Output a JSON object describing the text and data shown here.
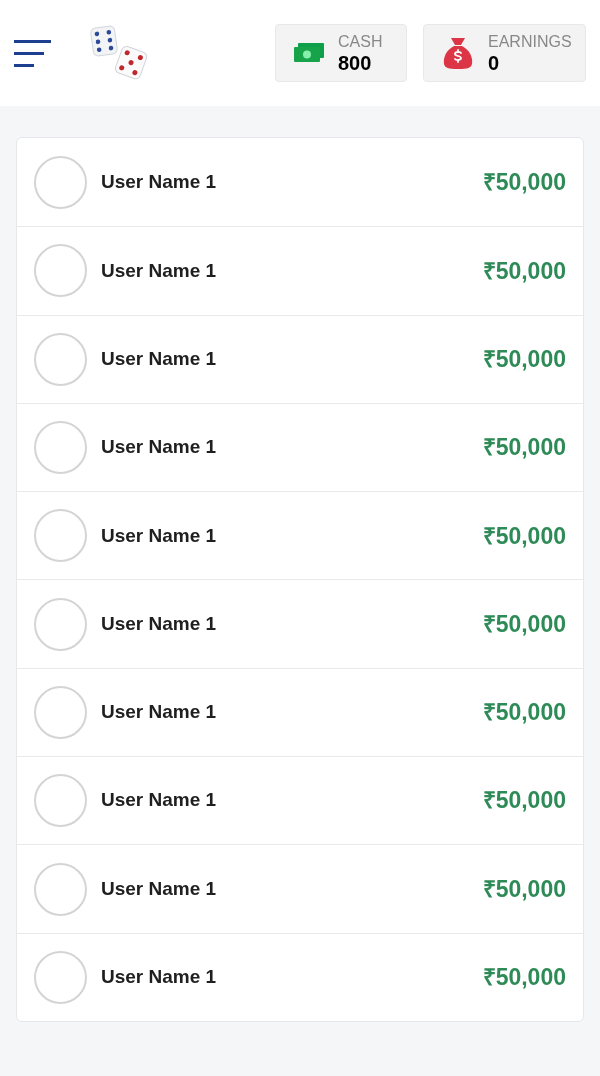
{
  "header": {
    "stats": [
      {
        "kind": "cash",
        "label": "CASH",
        "value": "800"
      },
      {
        "kind": "earnings",
        "label": "EARNINGS",
        "value": "0"
      }
    ]
  },
  "leaderboard": [
    {
      "name": "User Name 1",
      "amount": "₹50,000"
    },
    {
      "name": "User Name 1",
      "amount": "₹50,000"
    },
    {
      "name": "User Name 1",
      "amount": "₹50,000"
    },
    {
      "name": "User Name 1",
      "amount": "₹50,000"
    },
    {
      "name": "User Name 1",
      "amount": "₹50,000"
    },
    {
      "name": "User Name 1",
      "amount": "₹50,000"
    },
    {
      "name": "User Name 1",
      "amount": "₹50,000"
    },
    {
      "name": "User Name 1",
      "amount": "₹50,000"
    },
    {
      "name": "User Name 1",
      "amount": "₹50,000"
    },
    {
      "name": "User Name 1",
      "amount": "₹50,000"
    }
  ]
}
